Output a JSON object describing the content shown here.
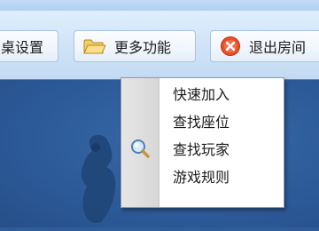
{
  "toolbar": {
    "table_settings_label": "桌设置",
    "more_features_label": "更多功能",
    "exit_room_label": "退出房间"
  },
  "menu": {
    "items": [
      {
        "label": "快速加入",
        "icon": null
      },
      {
        "label": "查找座位",
        "icon": null
      },
      {
        "label": "查找玩家",
        "icon": "magnifier-icon"
      },
      {
        "label": "游戏规则",
        "icon": null
      }
    ]
  },
  "colors": {
    "toolbar_bg": "#cfe3f7",
    "main_bg": "#2f5d99",
    "menu_gutter": "#dcdcdc",
    "exit_icon": "#e8502a",
    "folder_icon": "#f2c45a"
  }
}
